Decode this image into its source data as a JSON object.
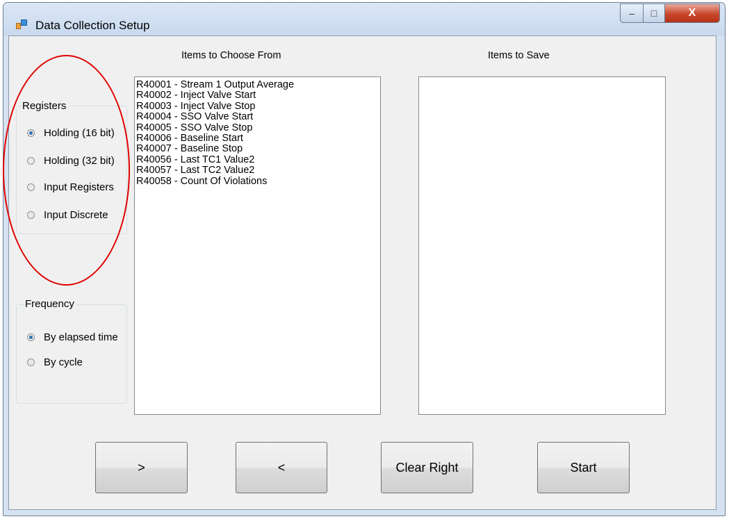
{
  "window": {
    "title": "Data Collection Setup",
    "controls": {
      "minimize": "–",
      "maximize": "□",
      "close": "X"
    }
  },
  "choose_panel": {
    "header": "Items to Choose From",
    "items": [
      "R40001 - Stream 1 Output Average",
      "R40002 - Inject Valve Start",
      "R40003 - Inject Valve Stop",
      "R40004 - SSO Valve Start",
      "R40005 - SSO Valve Stop",
      "R40006 - Baseline Start",
      "R40007 - Baseline Stop",
      "R40056 - Last TC1 Value2",
      "R40057 - Last TC2 Value2",
      "R40058 - Count Of Violations"
    ]
  },
  "save_panel": {
    "header": "Items to Save",
    "items": []
  },
  "registers": {
    "label": "Registers",
    "options": [
      "Holding (16 bit)",
      "Holding (32 bit)",
      "Input Registers",
      "Input Discrete"
    ],
    "selected": "Holding (16 bit)"
  },
  "frequency": {
    "label": "Frequency",
    "options": [
      "By elapsed time",
      "By cycle"
    ],
    "selected": "By elapsed time"
  },
  "buttons": {
    "add": ">",
    "remove": "<",
    "clear_right": "Clear Right",
    "start": "Start"
  },
  "annotation": {
    "color": "#e00000"
  },
  "icons": [
    "app-icon",
    "minimize-icon",
    "maximize-icon",
    "close-icon"
  ]
}
